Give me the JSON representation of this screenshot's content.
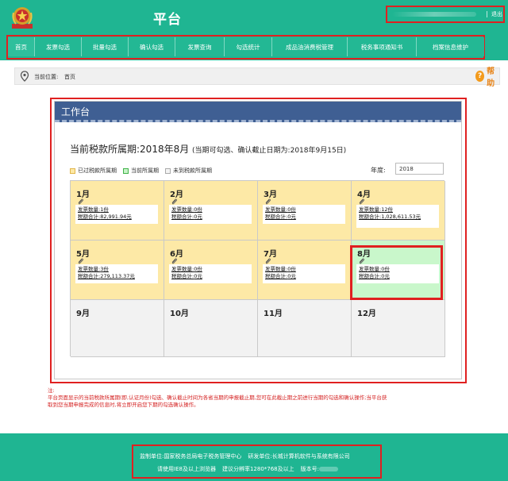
{
  "header": {
    "title": "平台",
    "logout": "退出"
  },
  "nav": [
    {
      "label": "首页",
      "active": true
    },
    {
      "label": "发票勾选"
    },
    {
      "label": "批量勾选"
    },
    {
      "label": "确认勾选"
    },
    {
      "label": "发票查询"
    },
    {
      "label": "勾选统计"
    },
    {
      "label": "成品油消费税管理"
    },
    {
      "label": "税务事项通知书"
    },
    {
      "label": "档案信息维护"
    }
  ],
  "breadcrumb": {
    "prefix": "当前位置:",
    "current": "首页"
  },
  "help": {
    "label": "帮助"
  },
  "panel": {
    "title": "工作台",
    "period_label": "当前税款所属期:2018年8月",
    "period_note": "(当期可勾选、确认截止日期为:2018年9月15日)",
    "legend": {
      "past": "已过税款所属期",
      "current": "当前所属期",
      "future": "未到税款所属期"
    },
    "year_label": "年度:",
    "year_value": "2018",
    "labels": {
      "count": "发票数量:",
      "tax": "税额合计:"
    },
    "months": [
      {
        "name": "1月",
        "status": "past",
        "count": "1份",
        "tax": "82,991.94元"
      },
      {
        "name": "2月",
        "status": "past",
        "count": "0份",
        "tax": "0元"
      },
      {
        "name": "3月",
        "status": "past",
        "count": "0份",
        "tax": "0元"
      },
      {
        "name": "4月",
        "status": "past",
        "count": "12份",
        "tax": "1,028,611.53元"
      },
      {
        "name": "5月",
        "status": "past",
        "count": "3份",
        "tax": "279,113.37元"
      },
      {
        "name": "6月",
        "status": "past",
        "count": "0份",
        "tax": "0元"
      },
      {
        "name": "7月",
        "status": "past",
        "count": "0份",
        "tax": "0元"
      },
      {
        "name": "8月",
        "status": "current",
        "count": "0份",
        "tax": "0元"
      },
      {
        "name": "9月",
        "status": "future"
      },
      {
        "name": "10月",
        "status": "future"
      },
      {
        "name": "11月",
        "status": "future"
      },
      {
        "name": "12月",
        "status": "future"
      }
    ]
  },
  "notes": {
    "title": "注:",
    "line1": "平台页面显示的当前税款所属期(即,认证月份)勾选、确认截止时间为各省当期的申报截止期,您可在此截止期之前进行当期的勾选和确认操作;当平台获",
    "line2": "取到您当期申报完成的信息时,将立即开启您下期的勾选确认操作。"
  },
  "footer": {
    "supervisor": "监制单位:国家税务总局电子税务管理中心",
    "developer": "研发单位:长城计算机软件与系统有限公司",
    "browser": "请使用IE8及以上浏览器",
    "resolution": "建议分辨率1280*768及以上",
    "version_label": "版本号:"
  },
  "colors": {
    "brand": "#1fb592",
    "panel_header": "#3f5f93",
    "past": "#fde9a6",
    "current": "#c9f7cb",
    "future": "#f2f2f2",
    "highlight": "#e02020",
    "help": "#f39a1b"
  }
}
